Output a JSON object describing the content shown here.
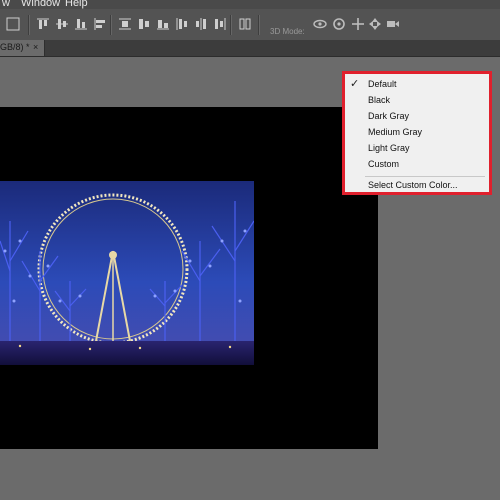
{
  "menubar": {
    "items": [
      {
        "label": "w"
      },
      {
        "label": "Window"
      },
      {
        "label": "Help"
      }
    ]
  },
  "optionsbar": {
    "mode_3d_label": "3D Mode:"
  },
  "document_tab": {
    "title": "GB/8) *",
    "close": "×"
  },
  "context_menu": {
    "check_mark": "✓",
    "items": [
      {
        "label": "Default",
        "checked": true
      },
      {
        "label": "Black"
      },
      {
        "label": "Dark Gray"
      },
      {
        "label": "Medium Gray"
      },
      {
        "label": "Light Gray"
      },
      {
        "label": "Custom"
      },
      {
        "label": "Select Custom Color..."
      }
    ]
  },
  "colors": {
    "highlight_border": "#e0202d",
    "canvas_background": "#000000",
    "workspace_background": "#6b6b6b"
  }
}
